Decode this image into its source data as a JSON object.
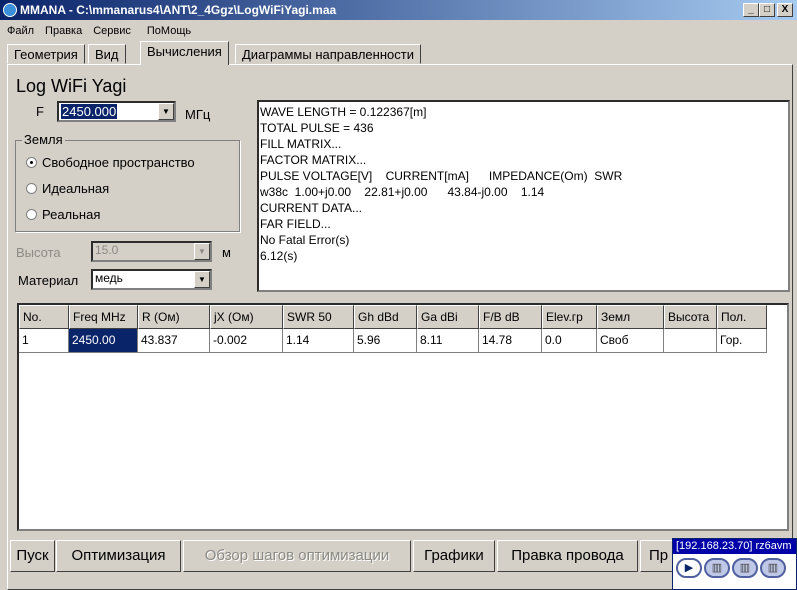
{
  "window": {
    "title": "MMANA - C:\\mmanarus4\\ANT\\2_4Ggz\\LogWiFiYagi.maa",
    "min": "_",
    "max": "□",
    "close": "X"
  },
  "menu": [
    "Файл",
    "Правка",
    "Сервис",
    "ПоМощь"
  ],
  "tabs": [
    "Геометрия",
    "Вид",
    "Вычисления",
    "Диаграммы направленности"
  ],
  "heading": "Log WiFi Yagi",
  "freq": {
    "label": "F",
    "value": "2450.000",
    "unit": "МГц"
  },
  "ground": {
    "title": "Земля",
    "options": [
      "Свободное пространство",
      "Идеальная",
      "Реальная"
    ],
    "selected": 0
  },
  "height": {
    "label": "Высота",
    "value": "15.0",
    "unit": "м"
  },
  "material": {
    "label": "Материал",
    "value": "медь"
  },
  "log": [
    "WAVE LENGTH = 0.122367[m]",
    "TOTAL PULSE = 436",
    "FILL MATRIX...",
    "FACTOR MATRIX...",
    "PULSE VOLTAGE[V]    CURRENT[mA]      IMPEDANCE(Om)  SWR",
    "w38c  1.00+j0.00    22.81+j0.00      43.84-j0.00    1.14",
    "CURRENT DATA...",
    "FAR FIELD...",
    "No Fatal Error(s)",
    "6.12(s)"
  ],
  "table": {
    "headers": [
      "No.",
      "Freq MHz",
      "R (Ом)",
      "jX (Ом)",
      "SWR 50",
      "Gh dBd",
      "Ga dBi",
      "F/B dB",
      "Elev.гр",
      "Земл",
      "Высота",
      "Пол."
    ],
    "rows": [
      [
        "1",
        "2450.00",
        "43.837",
        "-0.002",
        "1.14",
        "5.96",
        "8.11",
        "14.78",
        "0.0",
        "Своб",
        "",
        "Гор."
      ]
    ]
  },
  "buttons": [
    "Пуск",
    "Оптимизация",
    "Обзор шагов оптимизации",
    "Графики",
    "Правка провода",
    "Пр"
  ],
  "widget": {
    "title": "[192.168.23.70] rz6avm"
  }
}
